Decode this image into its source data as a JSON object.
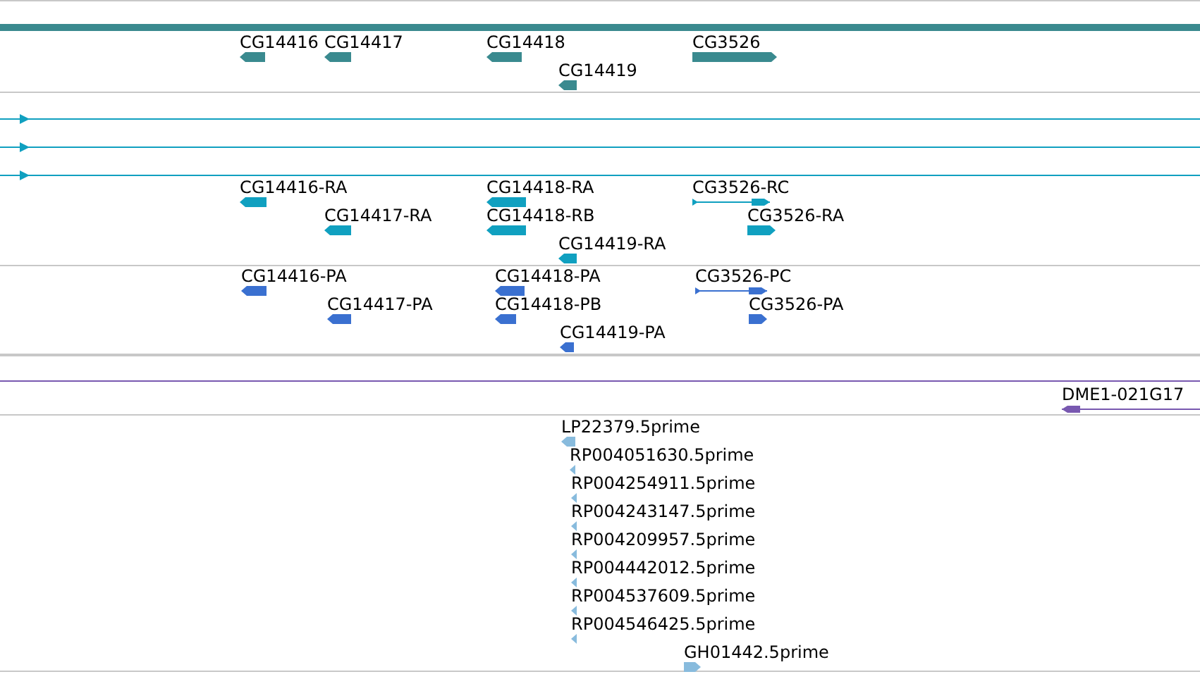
{
  "tracks": [
    {
      "kind": "scaffold"
    },
    {
      "kind": "genes",
      "features": [
        {
          "label": "CG14416",
          "reverse": true
        },
        {
          "label": "CG14417",
          "reverse": true
        },
        {
          "label": "CG14418",
          "reverse": true
        },
        {
          "label": "CG14419",
          "reverse": true
        },
        {
          "label": "CG3526",
          "reverse": false
        }
      ]
    },
    {
      "kind": "spanning",
      "lines": [
        {
          "reverse": false
        },
        {
          "reverse": false
        },
        {
          "reverse": false
        }
      ]
    },
    {
      "kind": "transcripts",
      "features": [
        {
          "label": "CG14416-RA",
          "reverse": true
        },
        {
          "label": "CG14417-RA",
          "reverse": true
        },
        {
          "label": "CG14418-RA",
          "reverse": true
        },
        {
          "label": "CG14418-RB",
          "reverse": true
        },
        {
          "label": "CG14419-RA",
          "reverse": true
        },
        {
          "label": "CG3526-RC",
          "reverse": false
        },
        {
          "label": "CG3526-RA",
          "reverse": false
        }
      ]
    },
    {
      "kind": "proteins",
      "features": [
        {
          "label": "CG14416-PA",
          "reverse": true
        },
        {
          "label": "CG14417-PA",
          "reverse": true
        },
        {
          "label": "CG14418-PA",
          "reverse": true
        },
        {
          "label": "CG14418-PB",
          "reverse": true
        },
        {
          "label": "CG14419-PA",
          "reverse": true
        },
        {
          "label": "CG3526-PC",
          "reverse": false
        },
        {
          "label": "CG3526-PA",
          "reverse": false
        }
      ]
    },
    {
      "kind": "clones",
      "features": [
        {
          "label": "DME1-021G17",
          "reverse": true
        }
      ]
    },
    {
      "kind": "ests",
      "features": [
        {
          "label": "LP22379.5prime",
          "reverse": true
        },
        {
          "label": "RP004051630.5prime",
          "reverse": true
        },
        {
          "label": "RP004254911.5prime",
          "reverse": true
        },
        {
          "label": "RP004243147.5prime",
          "reverse": true
        },
        {
          "label": "RP004209957.5prime",
          "reverse": true
        },
        {
          "label": "RP004442012.5prime",
          "reverse": true
        },
        {
          "label": "RP004537609.5prime",
          "reverse": true
        },
        {
          "label": "RP004546425.5prime",
          "reverse": true
        },
        {
          "label": "GH01442.5prime",
          "reverse": false
        }
      ]
    }
  ]
}
